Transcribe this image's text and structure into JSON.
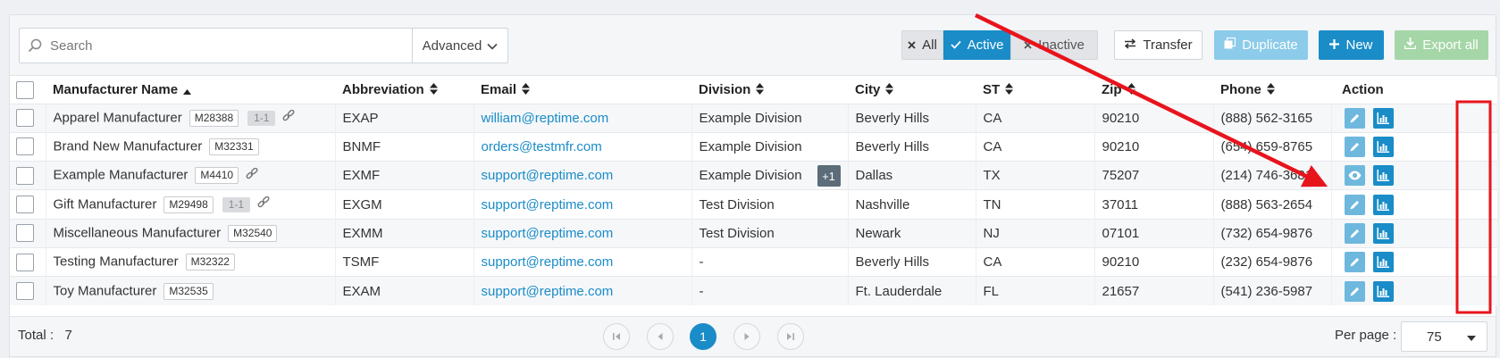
{
  "toolbar": {
    "search_placeholder": "Search",
    "advanced_label": "Advanced",
    "filter_all": "All",
    "filter_active": "Active",
    "filter_inactive": "Inactive",
    "transfer_label": "Transfer",
    "duplicate_label": "Duplicate",
    "new_label": "New",
    "export_label": "Export all"
  },
  "columns": {
    "name": "Manufacturer Name",
    "abbr": "Abbreviation",
    "email": "Email",
    "division": "Division",
    "city": "City",
    "st": "ST",
    "zip": "Zip",
    "phone": "Phone",
    "action": "Action"
  },
  "rows": [
    {
      "name": "Apparel Manufacturer",
      "code": "M28388",
      "version": "1-1",
      "linked": true,
      "abbr": "EXAP",
      "email": "william@reptime.com",
      "division": "Example Division",
      "extra": "",
      "city": "Beverly Hills",
      "st": "CA",
      "zip": "90210",
      "phone": "(888) 562-3165",
      "primary_action": "edit"
    },
    {
      "name": "Brand New Manufacturer",
      "code": "M32331",
      "version": "",
      "linked": false,
      "abbr": "BNMF",
      "email": "orders@testmfr.com",
      "division": "Example Division",
      "extra": "",
      "city": "Beverly Hills",
      "st": "CA",
      "zip": "90210",
      "phone": "(654) 659-8765",
      "primary_action": "edit"
    },
    {
      "name": "Example Manufacturer",
      "code": "M4410",
      "version": "",
      "linked": true,
      "abbr": "EXMF",
      "email": "support@reptime.com",
      "division": "Example Division",
      "extra": "+1",
      "city": "Dallas",
      "st": "TX",
      "zip": "75207",
      "phone": "(214) 746-3681",
      "primary_action": "view"
    },
    {
      "name": "Gift Manufacturer",
      "code": "M29498",
      "version": "1-1",
      "linked": true,
      "abbr": "EXGM",
      "email": "support@reptime.com",
      "division": "Test Division",
      "extra": "",
      "city": "Nashville",
      "st": "TN",
      "zip": "37011",
      "phone": "(888) 563-2654",
      "primary_action": "edit"
    },
    {
      "name": "Miscellaneous Manufacturer",
      "code": "M32540",
      "version": "",
      "linked": false,
      "abbr": "EXMM",
      "email": "support@reptime.com",
      "division": "Test Division",
      "extra": "",
      "city": "Newark",
      "st": "NJ",
      "zip": "07101",
      "phone": "(732) 654-9876",
      "primary_action": "edit"
    },
    {
      "name": "Testing Manufacturer",
      "code": "M32322",
      "version": "",
      "linked": false,
      "abbr": "TSMF",
      "email": "support@reptime.com",
      "division": "-",
      "extra": "",
      "city": "Beverly Hills",
      "st": "CA",
      "zip": "90210",
      "phone": "(232) 654-9876",
      "primary_action": "edit"
    },
    {
      "name": "Toy Manufacturer",
      "code": "M32535",
      "version": "",
      "linked": false,
      "abbr": "EXAM",
      "email": "support@reptime.com",
      "division": "-",
      "extra": "",
      "city": "Ft. Lauderdale",
      "st": "FL",
      "zip": "21657",
      "phone": "(541) 236-5987",
      "primary_action": "edit"
    }
  ],
  "footer": {
    "total_label": "Total :",
    "total_value": "7",
    "current_page": "1",
    "per_page_label": "Per page :",
    "per_page_value": "75"
  },
  "colors": {
    "accent": "#1a8cc8",
    "annotation": "#e8141c"
  }
}
